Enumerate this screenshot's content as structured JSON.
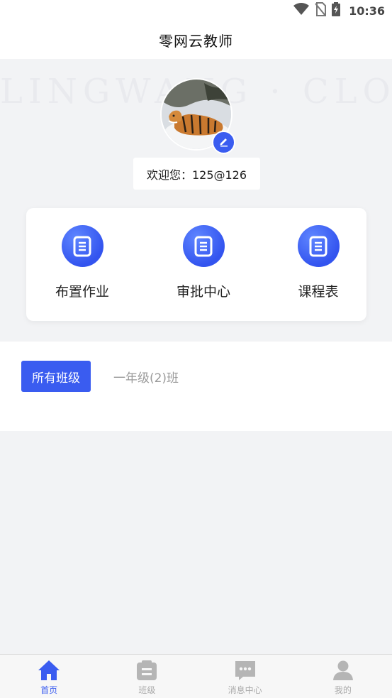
{
  "status_bar": {
    "time": "10:36"
  },
  "header": {
    "title": "零网云教师"
  },
  "profile": {
    "welcome_text": "欢迎您：125@126"
  },
  "menu": {
    "items": [
      {
        "label": "布置作业",
        "icon": "document-icon"
      },
      {
        "label": "审批中心",
        "icon": "document-icon"
      },
      {
        "label": "课程表",
        "icon": "document-icon"
      }
    ]
  },
  "class_filter": {
    "options": [
      {
        "label": "所有班级",
        "selected": true
      },
      {
        "label": "一年级(2)班",
        "selected": false
      }
    ]
  },
  "bottom_nav": {
    "items": [
      {
        "label": "首页",
        "icon": "home-icon",
        "active": true
      },
      {
        "label": "班级",
        "icon": "class-icon",
        "active": false
      },
      {
        "label": "消息中心",
        "icon": "message-icon",
        "active": false
      },
      {
        "label": "我的",
        "icon": "user-icon",
        "active": false
      }
    ]
  },
  "colors": {
    "accent": "#3a5cf0",
    "background": "#f2f3f5",
    "inactive_text": "#aaaaaa"
  }
}
